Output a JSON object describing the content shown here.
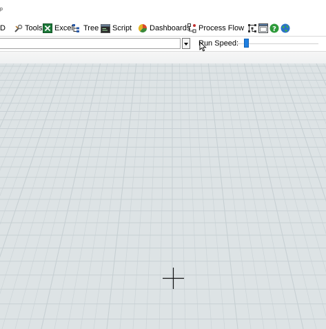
{
  "menu": {
    "fragment": "p"
  },
  "toolbar": {
    "d_fragment": "D",
    "tools_label": "Tools",
    "excel_label": "Excel",
    "tree_label": "Tree",
    "script_label": "Script",
    "dashboards_label": "Dashboards",
    "process_flow_label": "Process Flow"
  },
  "speed": {
    "run_speed_label": "Run Speed:",
    "selected_value": "",
    "level": 0.1
  },
  "colors": {
    "viewport_bg": "#dde3e5",
    "grid_line": "#c6cfd3",
    "slider_thumb": "#1f7fe0"
  },
  "icons": {
    "tools": "tools-icon",
    "excel": "excel-icon",
    "tree": "tree-icon",
    "script": "script-icon",
    "dashboards": "dashboards-icon",
    "process_flow": "process-flow-icon",
    "model_layout": "model-layout-icon",
    "window": "window-icon",
    "help": "help-icon",
    "online": "globe-icon"
  }
}
